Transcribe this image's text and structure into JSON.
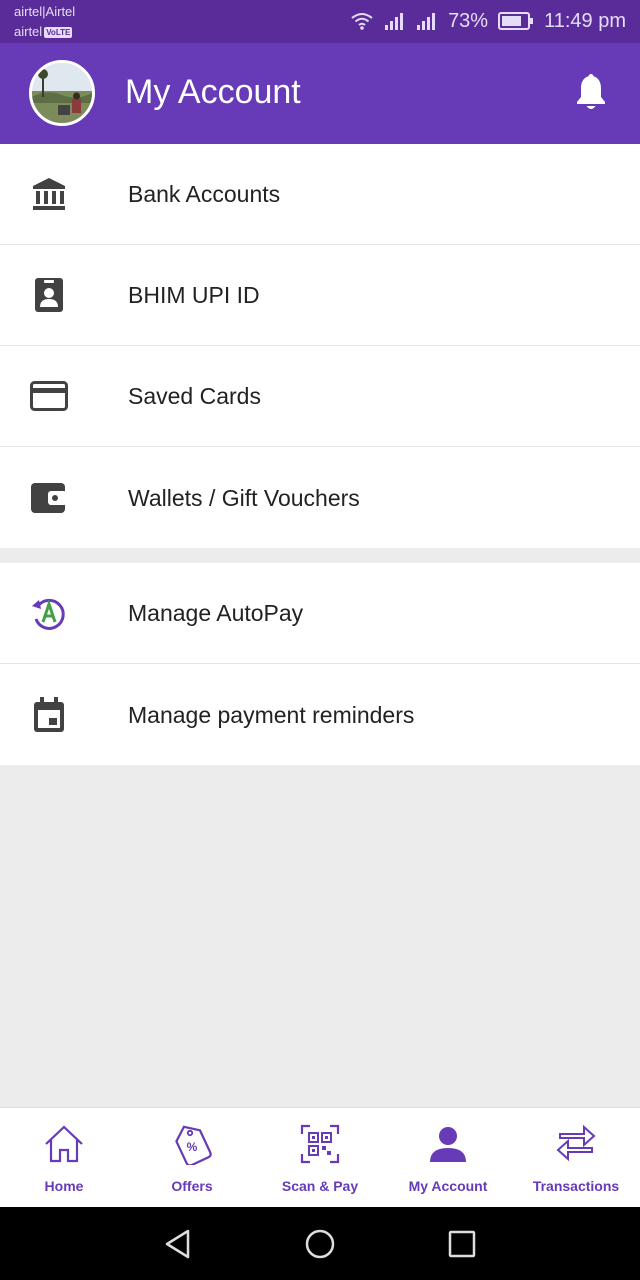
{
  "status_bar": {
    "carrier_line1": "airtel|Airtel",
    "carrier_line2": "airtel",
    "volte_badge": "VoLTE",
    "battery_percent": "73%",
    "time": "11:49 pm"
  },
  "header": {
    "title": "My Account"
  },
  "account_menu": [
    {
      "label": "Bank Accounts",
      "icon": "bank-icon"
    },
    {
      "label": "BHIM UPI ID",
      "icon": "id-badge-icon"
    },
    {
      "label": "Saved Cards",
      "icon": "credit-card-icon"
    },
    {
      "label": "Wallets / Gift Vouchers",
      "icon": "wallet-icon"
    }
  ],
  "payment_menu": [
    {
      "label": "Manage AutoPay",
      "icon": "autopay-icon"
    },
    {
      "label": "Manage payment reminders",
      "icon": "calendar-icon"
    }
  ],
  "bottom_nav": [
    {
      "label": "Home",
      "icon": "home-icon"
    },
    {
      "label": "Offers",
      "icon": "offers-tag-icon"
    },
    {
      "label": "Scan & Pay",
      "icon": "qr-scan-icon"
    },
    {
      "label": "My Account",
      "icon": "account-person-icon",
      "active": true
    },
    {
      "label": "Transactions",
      "icon": "transactions-arrows-icon"
    }
  ],
  "colors": {
    "primary": "#673ab7",
    "status_bar": "#5a2c9a",
    "icon_gray": "#424242",
    "autopay_green": "#43a047",
    "background": "#ececec"
  }
}
